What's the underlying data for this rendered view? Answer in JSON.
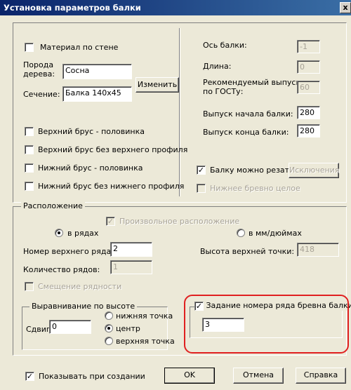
{
  "window": {
    "title": "Установка параметров балки",
    "close": "x"
  },
  "left": {
    "material_label": "Материал по стене",
    "poroda_line1": "Порода",
    "poroda_line2": "дерева:",
    "poroda_value": "Сосна",
    "change_button": "Изменить",
    "section_label": "Сечение:",
    "section_value": "Балка 140х45",
    "checks": [
      "Верхний брус - половинка",
      "Верхний брус без верхнего профиля",
      "Нижний брус - половинка",
      "Нижний брус без нижнего профиля"
    ]
  },
  "right": {
    "axis_label": "Ось балки:",
    "axis_value": "-1",
    "length_label": "Длина:",
    "length_value": "0",
    "rec_line1": "Рекомендуемый выпуск",
    "rec_line2": "по ГОСТу:",
    "rec_value": "60",
    "start_label": "Выпуск начала балки:",
    "start_value": "280",
    "end_label": "Выпуск конца балки:",
    "end_value": "280",
    "can_cut_label": "Балку можно резать",
    "exceptions_button": "Исключения",
    "bottom_whole_label": "Нижнее бревно целое"
  },
  "placement": {
    "title": "Расположение",
    "arbitrary_label": "Произвольное расположение",
    "in_rows_label": "в рядах",
    "in_mm_label": "в мм/дюймах",
    "top_row_label": "Номер верхнего ряда:",
    "top_row_value": "2",
    "top_point_label": "Высота верхней точки:",
    "top_point_value": "418",
    "rows_count_label": "Количество рядов:",
    "rows_count_value": "1",
    "offset_label": "Смещение рядности"
  },
  "align": {
    "title": "Выравнивание по высоте",
    "shift_label": "Сдвиг:",
    "shift_value": "0",
    "options": [
      "нижняя точка",
      "центр",
      "верхняя точка"
    ]
  },
  "row_number": {
    "label": "Задание номера ряда бревна балки",
    "value": "3"
  },
  "footer": {
    "show_on_create_label": "Показывать при создании",
    "ok_button": "OK",
    "cancel_button": "Отмена",
    "help_button": "Справка"
  },
  "colors": {
    "highlight": "#e02020",
    "title_bg": "#0a246a",
    "window_bg": "#ece9d8"
  }
}
